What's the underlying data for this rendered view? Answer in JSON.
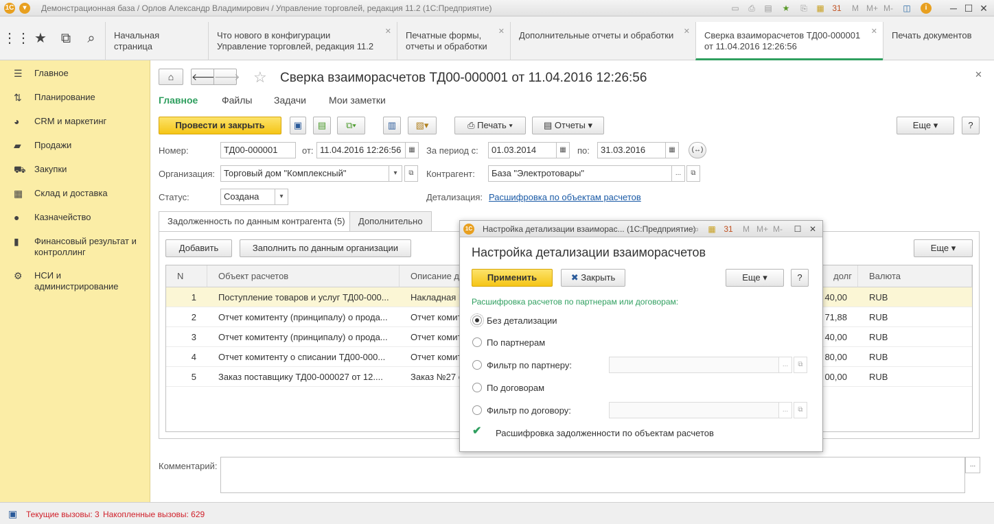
{
  "window": {
    "title": "Демонстрационная база / Орлов Александр Владимирович / Управление торговлей, редакция 11.2  (1С:Предприятие)"
  },
  "tabs": [
    {
      "label": "Начальная страница"
    },
    {
      "label": "Что нового в конфигурации Управление торговлей, редакция 11.2"
    },
    {
      "label": "Печатные формы, отчеты и обработки"
    },
    {
      "label": "Дополнительные отчеты и обработки"
    },
    {
      "label": "Сверка взаиморасчетов ТД00-000001 от 11.04.2016 12:26:56"
    },
    {
      "label": "Печать документов"
    }
  ],
  "sidebar": {
    "items": [
      {
        "label": "Главное",
        "icon": "menu-icon"
      },
      {
        "label": "Планирование",
        "icon": "planning-icon"
      },
      {
        "label": "CRM и маркетинг",
        "icon": "crm-icon"
      },
      {
        "label": "Продажи",
        "icon": "sales-icon"
      },
      {
        "label": "Закупки",
        "icon": "cart-icon"
      },
      {
        "label": "Склад и доставка",
        "icon": "warehouse-icon"
      },
      {
        "label": "Казначейство",
        "icon": "treasury-icon"
      },
      {
        "label": "Финансовый результат и контроллинг",
        "icon": "finance-chart-icon"
      },
      {
        "label": "НСИ и администрирование",
        "icon": "gear-icon"
      }
    ]
  },
  "doc": {
    "title": "Сверка взаиморасчетов ТД00-000001 от 11.04.2016 12:26:56",
    "menu": [
      "Главное",
      "Файлы",
      "Задачи",
      "Мои заметки"
    ],
    "toolbar": {
      "post_close": "Провести и закрыть",
      "print": "Печать",
      "reports": "Отчеты",
      "more": "Еще",
      "help": "?"
    },
    "fields": {
      "number_label": "Номер:",
      "number": "ТД00-000001",
      "from_label": "от:",
      "from": "11.04.2016 12:26:56",
      "period_label": "За период с:",
      "period_from": "01.03.2014",
      "to_label": "по:",
      "period_to": "31.03.2016",
      "org_label": "Организация:",
      "org": "Торговый дом \"Комплексный\"",
      "contractor_label": "Контрагент:",
      "contractor": "База \"Электротовары\"",
      "status_label": "Статус:",
      "status": "Создана",
      "detail_label": "Детализация:",
      "detail": "Расшифровка по объектам расчетов",
      "comment_label": "Комментарий:",
      "comment": ""
    },
    "form_tabs": [
      "Задолженность по данным контрагента (5)",
      "Дополнительно"
    ],
    "table_toolbar": {
      "add": "Добавить",
      "fill": "Заполнить по данным организации",
      "more": "Еще"
    },
    "table": {
      "headers": [
        "N",
        "Объект расчетов",
        "Описание д",
        "долг",
        "Валюта"
      ],
      "rows": [
        {
          "n": "1",
          "object": "Поступление товаров и услуг ТД00-000...",
          "desc": "Накладная М",
          "debt": "40,00",
          "cur": "RUB"
        },
        {
          "n": "2",
          "object": "Отчет комитенту (принципалу) о прода...",
          "desc": "Отчет комит",
          "debt": "71,88",
          "cur": "RUB"
        },
        {
          "n": "3",
          "object": "Отчет комитенту (принципалу) о прода...",
          "desc": "Отчет комит",
          "debt": "40,00",
          "cur": "RUB"
        },
        {
          "n": "4",
          "object": "Отчет комитенту о списании ТД00-000...",
          "desc": "Отчет комит",
          "debt": "80,00",
          "cur": "RUB"
        },
        {
          "n": "5",
          "object": "Заказ поставщику ТД00-000027 от 12....",
          "desc": "Заказ №27 о",
          "debt": "00,00",
          "cur": "RUB"
        }
      ]
    }
  },
  "dialog": {
    "window_title": "Настройка детализации взаиморас... (1С:Предприятие)",
    "title": "Настройка детализации взаиморасчетов",
    "apply": "Применить",
    "close": "Закрыть",
    "more": "Еще",
    "help": "?",
    "section": "Расшифровка расчетов по партнерам или договорам:",
    "options": [
      {
        "label": "Без детализации",
        "selected": true
      },
      {
        "label": "По партнерам",
        "selected": false
      },
      {
        "label": "Фильтр по партнеру:",
        "selected": false
      },
      {
        "label": "По договорам",
        "selected": false
      },
      {
        "label": "Фильтр по договору:",
        "selected": false
      }
    ],
    "checkbox": {
      "label": "Расшифровка задолженности по объектам расчетов",
      "checked": true
    }
  },
  "status": {
    "current_calls": "Текущие вызовы: 3",
    "accumulated_calls": "Накопленные вызовы: 629"
  },
  "colors": {
    "accent_green": "#2f9f5f",
    "sidebar_yellow": "#fbeda6",
    "primary_button": "#f5c516",
    "status_red": "#d0202a"
  }
}
